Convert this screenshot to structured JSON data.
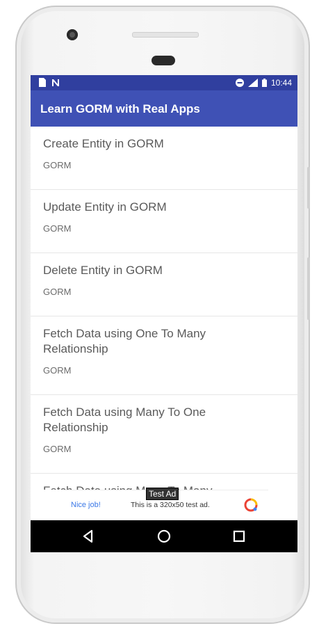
{
  "statusbar": {
    "time": "10:44"
  },
  "appbar": {
    "title": "Learn GORM with Real Apps"
  },
  "list": [
    {
      "title": "Create Entity in GORM",
      "subtitle": "GORM"
    },
    {
      "title": "Update Entity in GORM",
      "subtitle": "GORM"
    },
    {
      "title": "Delete Entity in GORM",
      "subtitle": "GORM"
    },
    {
      "title": "Fetch Data using One To Many Relationship",
      "subtitle": "GORM"
    },
    {
      "title": "Fetch Data using Many To One Relationship",
      "subtitle": "GORM"
    },
    {
      "title": "Fetch Data using Many To Many",
      "subtitle": ""
    }
  ],
  "ad": {
    "tag": "Test Ad",
    "nice": "Nice job!",
    "text": "This is a 320x50 test ad."
  },
  "colors": {
    "statusbar": "#303f9f",
    "appbar": "#3f51b5"
  },
  "icons": [
    "sim-icon",
    "notification-n-icon",
    "dnd-icon",
    "signal-icon",
    "battery-icon",
    "back-icon",
    "home-icon",
    "recents-icon",
    "admob-logo-icon"
  ]
}
